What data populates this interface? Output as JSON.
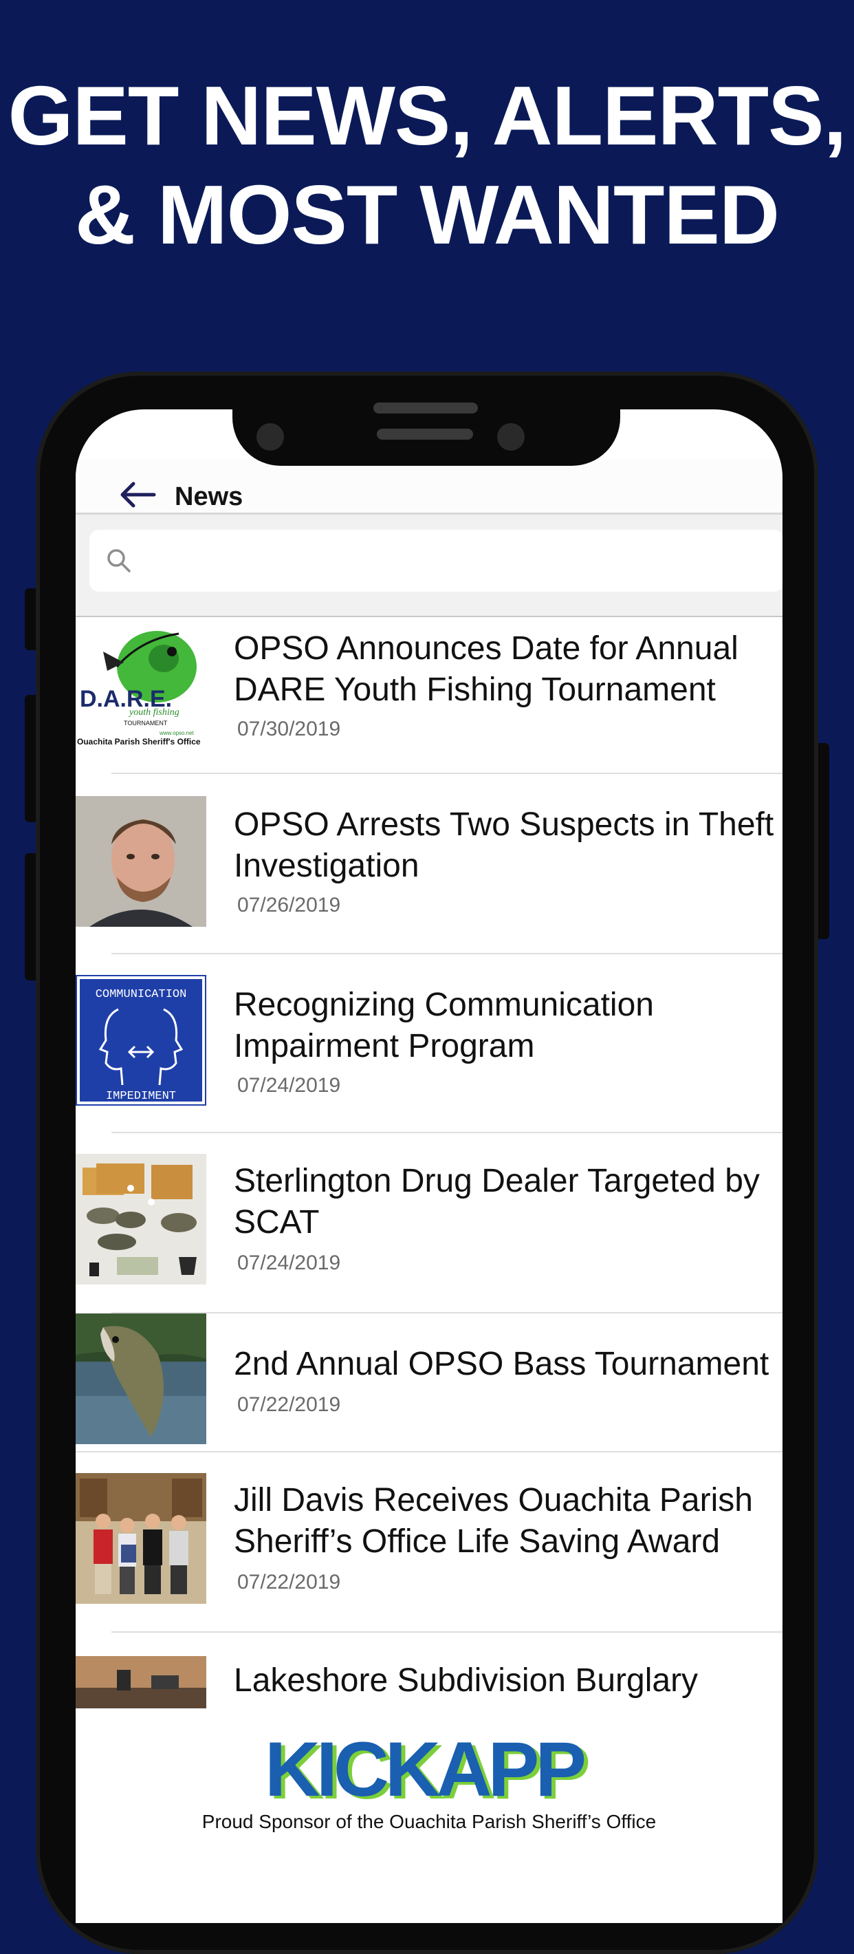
{
  "promo": {
    "line1": "GET NEWS, ALERTS,",
    "line2": "& MOST WANTED"
  },
  "nav": {
    "title": "News",
    "back_icon": "arrow-left-icon"
  },
  "search": {
    "placeholder": "",
    "icon": "search-icon"
  },
  "news": [
    {
      "title": "OPSO Announces Date for Annual DARE Youth Fishing Tournament",
      "date": "07/30/2019",
      "thumb": "dare-logo"
    },
    {
      "title": "OPSO Arrests Two Suspects in Theft Investigation",
      "date": "07/26/2019",
      "thumb": "mugshot"
    },
    {
      "title": "Recognizing Communication Impairment Program",
      "date": "07/24/2019",
      "thumb": "communication-impediment-sign"
    },
    {
      "title": "Sterlington Drug Dealer Targeted by SCAT",
      "date": "07/24/2019",
      "thumb": "seized-evidence"
    },
    {
      "title": "2nd Annual OPSO Bass Tournament",
      "date": "07/22/2019",
      "thumb": "bass-fish"
    },
    {
      "title": "Jill Davis Receives Ouachita Parish Sheriff’s Office Life Saving Award",
      "date": "07/22/2019",
      "thumb": "award-photo"
    },
    {
      "title": "Lakeshore Subdivision Burglary",
      "date": "",
      "thumb": "burglary-photo"
    }
  ],
  "thumb_text": {
    "dare": "D.A.R.E.",
    "dare_sub": "youth fishing",
    "dare_tournament": "TOURNAMENT",
    "dare_web": "www.opso.net",
    "dare_office": "Ouachita Parish Sheriff's Office",
    "comm_top": "COMMUNICATION",
    "comm_bottom": "IMPEDIMENT"
  },
  "footer": {
    "logo": "KICKAPP",
    "sponsor": "Proud Sponsor of the Ouachita Parish Sheriff’s Office"
  },
  "colors": {
    "background": "#0b1a57",
    "nav_accent": "#1e1f5c",
    "logo_blue": "#1a5fb0",
    "logo_green": "#7ccf3a"
  }
}
